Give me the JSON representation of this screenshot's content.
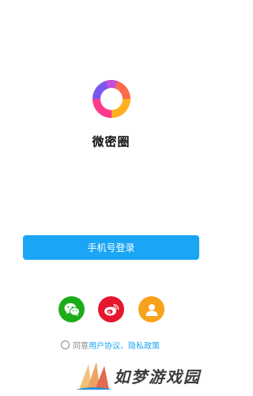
{
  "app": {
    "name": "微密圈",
    "logo_icon": "ring-logo-icon"
  },
  "login": {
    "phone_button_label": "手机号登录",
    "accent_color": "#1aa6f5"
  },
  "social": [
    {
      "name": "wechat-login",
      "icon": "wechat-icon",
      "color": "#1aad19"
    },
    {
      "name": "weibo-login",
      "icon": "weibo-icon",
      "color": "#e6162d"
    },
    {
      "name": "account-login",
      "icon": "user-icon",
      "color": "#f7a21b"
    }
  ],
  "agreement": {
    "prefix": "同意",
    "user_agreement": "用户协议",
    "separator": "、",
    "privacy_policy": "隐私政策",
    "link_color": "#1aa6f5"
  },
  "watermark": {
    "text": "如梦游戏园"
  }
}
